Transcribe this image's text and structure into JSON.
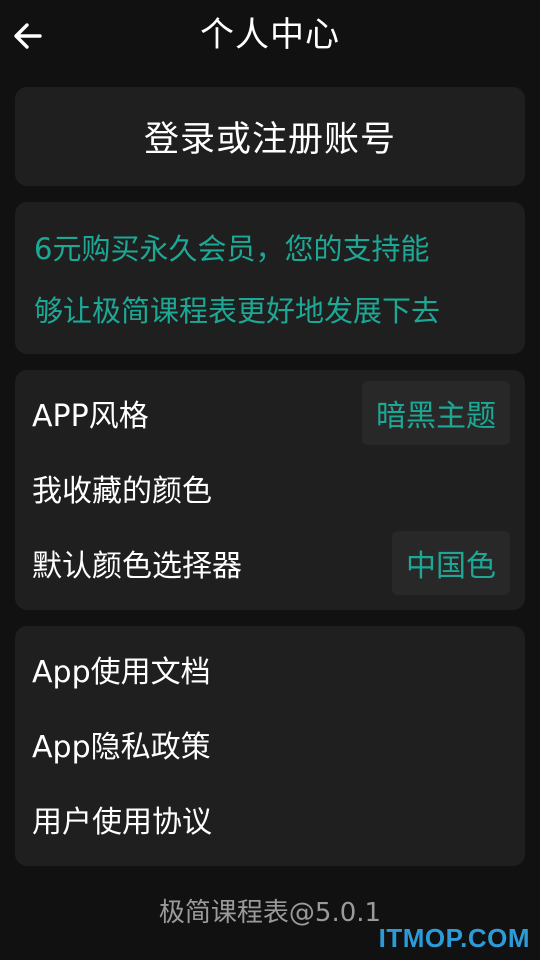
{
  "header": {
    "title": "个人中心",
    "back_icon": "arrow-left-icon"
  },
  "login": {
    "label": "登录或注册账号"
  },
  "promo": {
    "line1": "6元购买永久会员，您的支持能",
    "line2": "够让极简课程表更好地发展下去",
    "color": "#1da895"
  },
  "settings": {
    "app_style_label": "APP风格",
    "app_style_value": "暗黑主题",
    "favorite_colors_label": "我收藏的颜色",
    "default_picker_label": "默认颜色选择器",
    "default_picker_value": "中国色"
  },
  "docs": {
    "app_docs": "App使用文档",
    "privacy_policy": "App隐私政策",
    "user_agreement": "用户使用协议"
  },
  "footer": {
    "version": "极简课程表@5.0.1",
    "watermark": "ITMOP.COM"
  },
  "colors": {
    "background": "#111111",
    "card": "#1f1f1f",
    "accent": "#1da895"
  }
}
